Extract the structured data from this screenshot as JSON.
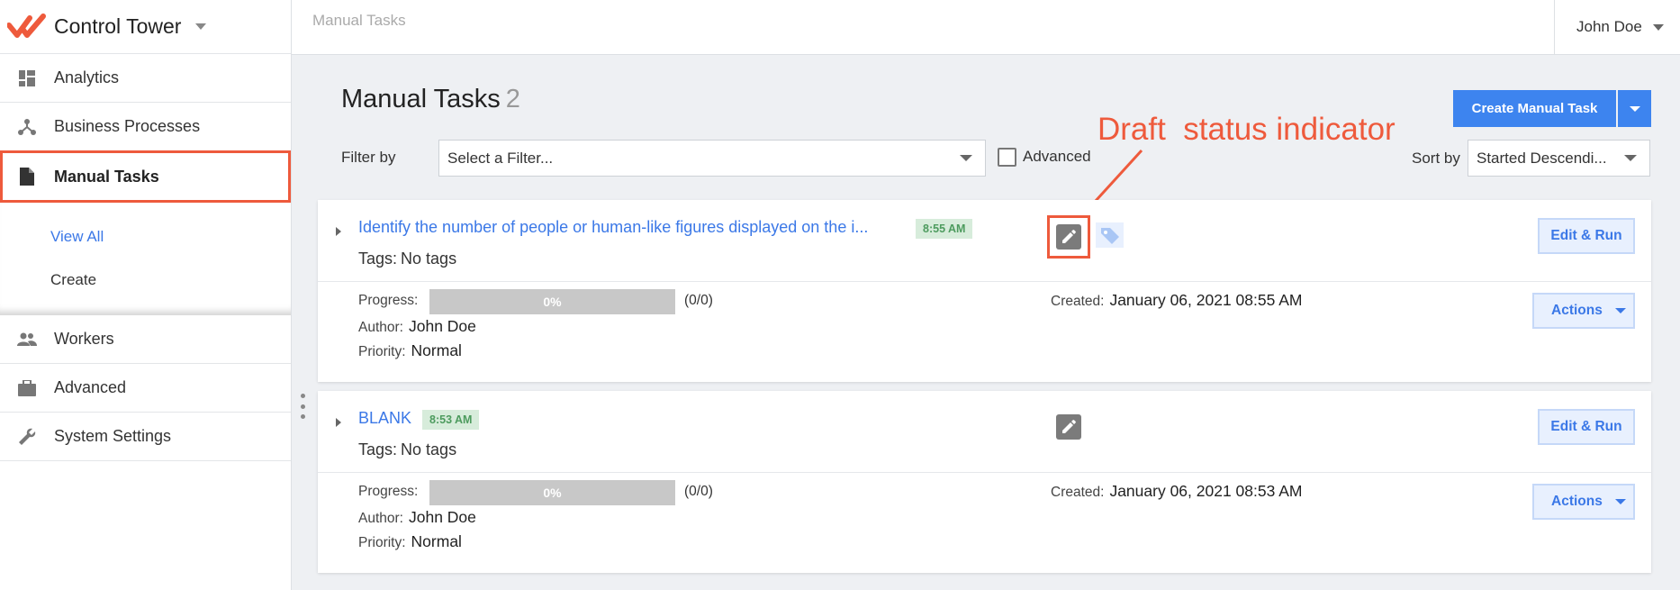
{
  "app": {
    "brand_name": "Control Tower",
    "user_name": "John Doe",
    "breadcrumb": "Manual Tasks"
  },
  "sidebar": {
    "items": [
      {
        "label": "Analytics",
        "icon": "dashboard-icon"
      },
      {
        "label": "Business Processes",
        "icon": "process-icon"
      },
      {
        "label": "Manual Tasks",
        "icon": "document-icon",
        "active": true
      },
      {
        "label": "Workers",
        "icon": "people-icon"
      },
      {
        "label": "Advanced",
        "icon": "briefcase-icon"
      },
      {
        "label": "System Settings",
        "icon": "wrench-icon"
      }
    ],
    "sub_items": [
      {
        "label": "View All"
      },
      {
        "label": "Create"
      }
    ]
  },
  "page": {
    "title": "Manual Tasks",
    "count": "2",
    "create_button": "Create Manual Task",
    "filter_label": "Filter by",
    "filter_placeholder": "Select a Filter...",
    "advanced_label": "Advanced",
    "sort_label": "Sort by",
    "sort_value": "Started Descendi..."
  },
  "annotation": {
    "text": "Draft  status indicator",
    "color": "#ee5a3c"
  },
  "labels": {
    "tags_prefix": "Tags:",
    "progress": "Progress:",
    "author": "Author:",
    "priority": "Priority:",
    "created": "Created:",
    "edit_run": "Edit & Run",
    "actions": "Actions"
  },
  "tasks": [
    {
      "title": "Identify the number of people or human-like figures displayed on the i...",
      "time": "8:55 AM",
      "tags": "No tags",
      "progress_percent": 0,
      "progress_label": "0%",
      "progress_count": "(0/0)",
      "author": "John Doe",
      "priority": "Normal",
      "created": "January 06, 2021 08:55 AM",
      "status": "draft",
      "status_icon": "pencil-icon",
      "has_tag_icon": true
    },
    {
      "title": "BLANK",
      "time": "8:53 AM",
      "tags": "No tags",
      "progress_percent": 0,
      "progress_label": "0%",
      "progress_count": "(0/0)",
      "author": "John Doe",
      "priority": "Normal",
      "created": "January 06, 2021 08:53 AM",
      "status": "draft",
      "status_icon": "pencil-icon",
      "has_tag_icon": false
    }
  ],
  "colors": {
    "accent": "#3d84ef",
    "link": "#3b78e7",
    "highlight": "#ee5a3c",
    "time_badge_bg": "#d7ecdb",
    "time_badge_fg": "#4d9b5e"
  }
}
